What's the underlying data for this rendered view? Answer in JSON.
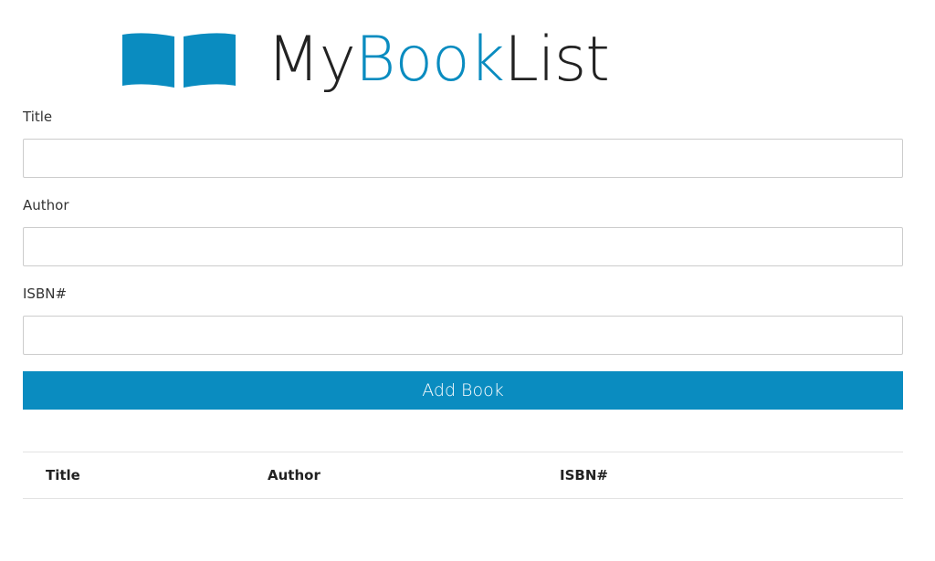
{
  "brand": {
    "name_prefix": "My",
    "name_accent": "Book",
    "name_suffix": "List",
    "icon": "open-book-icon",
    "accent_color": "#0a8cc0"
  },
  "form": {
    "title_label": "Title",
    "title_value": "",
    "author_label": "Author",
    "author_value": "",
    "isbn_label": "ISBN#",
    "isbn_value": "",
    "submit_label": "Add Book"
  },
  "table": {
    "columns": [
      "Title",
      "Author",
      "ISBN#"
    ],
    "rows": []
  }
}
